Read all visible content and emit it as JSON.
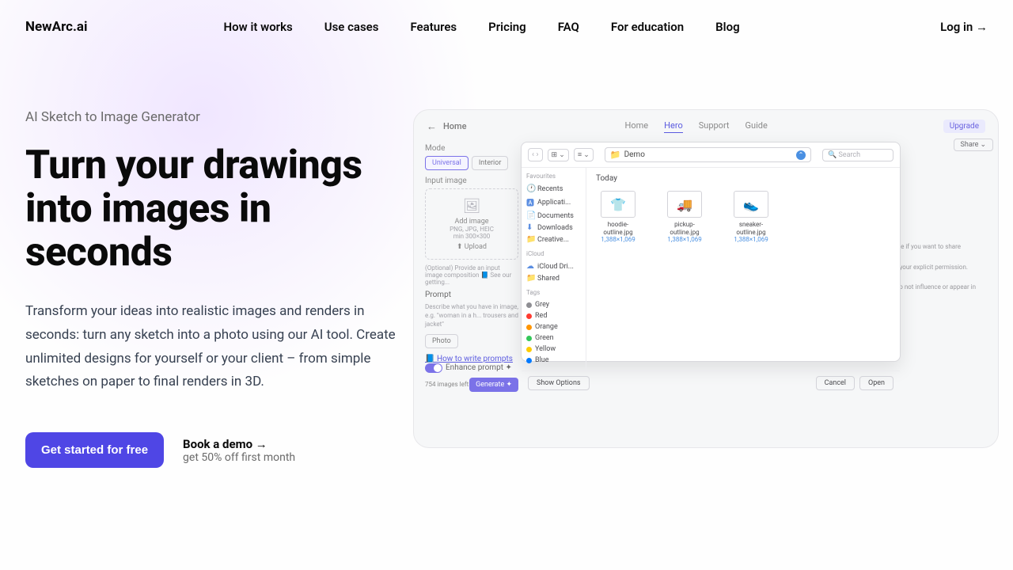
{
  "logo": "NewArc.ai",
  "nav": {
    "items": [
      "How it works",
      "Use cases",
      "Features",
      "Pricing",
      "FAQ",
      "For education",
      "Blog"
    ]
  },
  "login": "Log in →",
  "hero": {
    "eyebrow": "AI Sketch to Image Generator",
    "title": "Turn your drawings into images in seconds",
    "description": "Transform your ideas into realistic images and renders in seconds: turn any sketch into a photo using our AI tool. Create unlimited designs for yourself or your client – from simple sketches on paper to final renders in 3D.",
    "cta_primary": "Get started for free",
    "demo_title": "Book a demo →",
    "demo_sub": "get 50% off first month"
  },
  "preview": {
    "home": "Home",
    "tabs": [
      "Home",
      "Hero",
      "Support",
      "Guide"
    ],
    "upgrade": "Upgrade",
    "share": "Share",
    "mode_label": "Mode",
    "modes": [
      "Universal",
      "Interior"
    ],
    "input_image_label": "Input image",
    "upload": {
      "add": "Add image",
      "formats": "PNG, JPG, HEIC",
      "min": "min 300×300",
      "upload_label": "⬆ Upload"
    },
    "optional_text": "(Optional) Provide an input image composition 📘 See our getting...",
    "prompt": {
      "label": "Prompt",
      "hint": "Describe what you have in image, e.g. \"woman in a h... trousers and jacket\""
    },
    "photo_label": "Photo",
    "how_to_link": "How to write prompts",
    "enhance_label": "Enhance prompt ✦",
    "images_left": "754 images left",
    "generate": "Generate ✦",
    "right_text_1": "hoice if you want to share",
    "right_text_2": "out your explicit permission.",
    "right_text_3": "ed to not influence or appear in"
  },
  "finder": {
    "folder": "Demo",
    "search_placeholder": "Search",
    "today": "Today",
    "sidebar": {
      "favourites": "Favourites",
      "fav_items": [
        "Recents",
        "Applicati...",
        "Documents",
        "Downloads",
        "Creative..."
      ],
      "icloud": "iCloud",
      "icloud_items": [
        "iCloud Dri...",
        "Shared"
      ],
      "tags": "Tags",
      "tag_items": [
        {
          "name": "Grey",
          "color": "#8e8e93"
        },
        {
          "name": "Red",
          "color": "#ff3b30"
        },
        {
          "name": "Orange",
          "color": "#ff9500"
        },
        {
          "name": "Green",
          "color": "#34c759"
        },
        {
          "name": "Yellow",
          "color": "#ffcc00"
        },
        {
          "name": "Blue",
          "color": "#007aff"
        }
      ]
    },
    "files": [
      {
        "name": "hoodie-outline.jpg",
        "dims": "1,388×1,069"
      },
      {
        "name": "pickup-outline.jpg",
        "dims": "1,388×1,069"
      },
      {
        "name": "sneaker-outline.jpg",
        "dims": "1,388×1,069"
      }
    ],
    "show_options": "Show Options",
    "cancel": "Cancel",
    "open": "Open"
  }
}
